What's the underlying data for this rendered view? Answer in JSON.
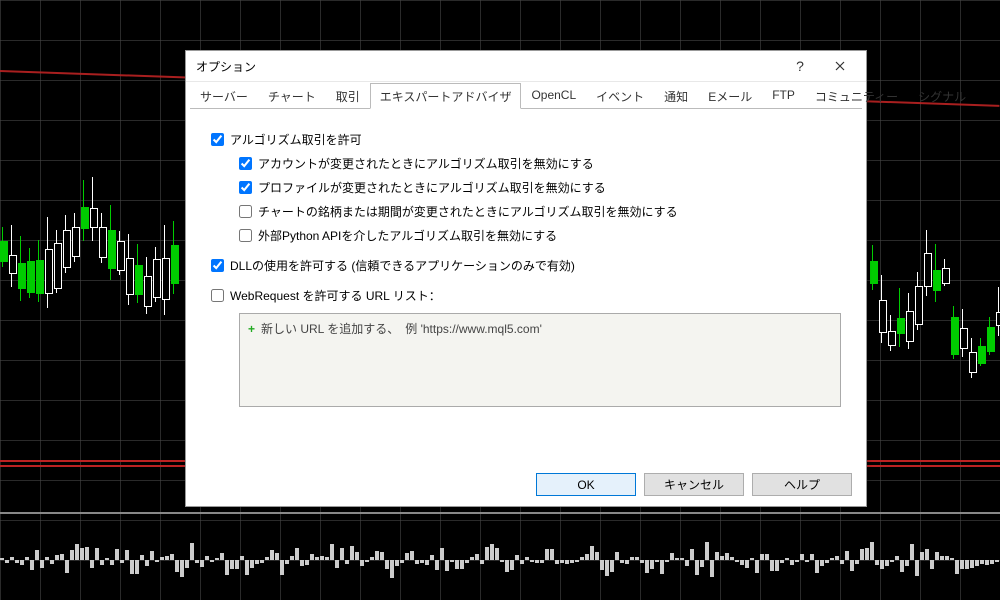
{
  "dialog": {
    "title": "オプション",
    "tabs": [
      "サーバー",
      "チャート",
      "取引",
      "エキスパートアドバイザ",
      "OpenCL",
      "イベント",
      "通知",
      "Eメール",
      "FTP",
      "コミュニティー",
      "シグナル"
    ],
    "active_tab_index": 3,
    "checkboxes": {
      "allow_algo": {
        "label": "アルゴリズム取引を許可",
        "checked": true
      },
      "disable_on_account": {
        "label": "アカウントが変更されたときにアルゴリズム取引を無効にする",
        "checked": true
      },
      "disable_on_profile": {
        "label": "プロファイルが変更されたときにアルゴリズム取引を無効にする",
        "checked": true
      },
      "disable_on_chart": {
        "label": "チャートの銘柄または期間が変更されたときにアルゴリズム取引を無効にする",
        "checked": false
      },
      "disable_python": {
        "label": "外部Python APIを介したアルゴリズム取引を無効にする",
        "checked": false
      },
      "allow_dll": {
        "label": "DLLの使用を許可する (信頼できるアプリケーションのみで有効)",
        "checked": true
      },
      "allow_webrequest": {
        "label": "WebRequest を許可する URL リスト：",
        "checked": false
      }
    },
    "url_placeholder": "新しい URL を追加する、　例 'https://www.mql5.com'",
    "buttons": {
      "ok": "OK",
      "cancel": "キャンセル",
      "help": "ヘルプ"
    }
  }
}
